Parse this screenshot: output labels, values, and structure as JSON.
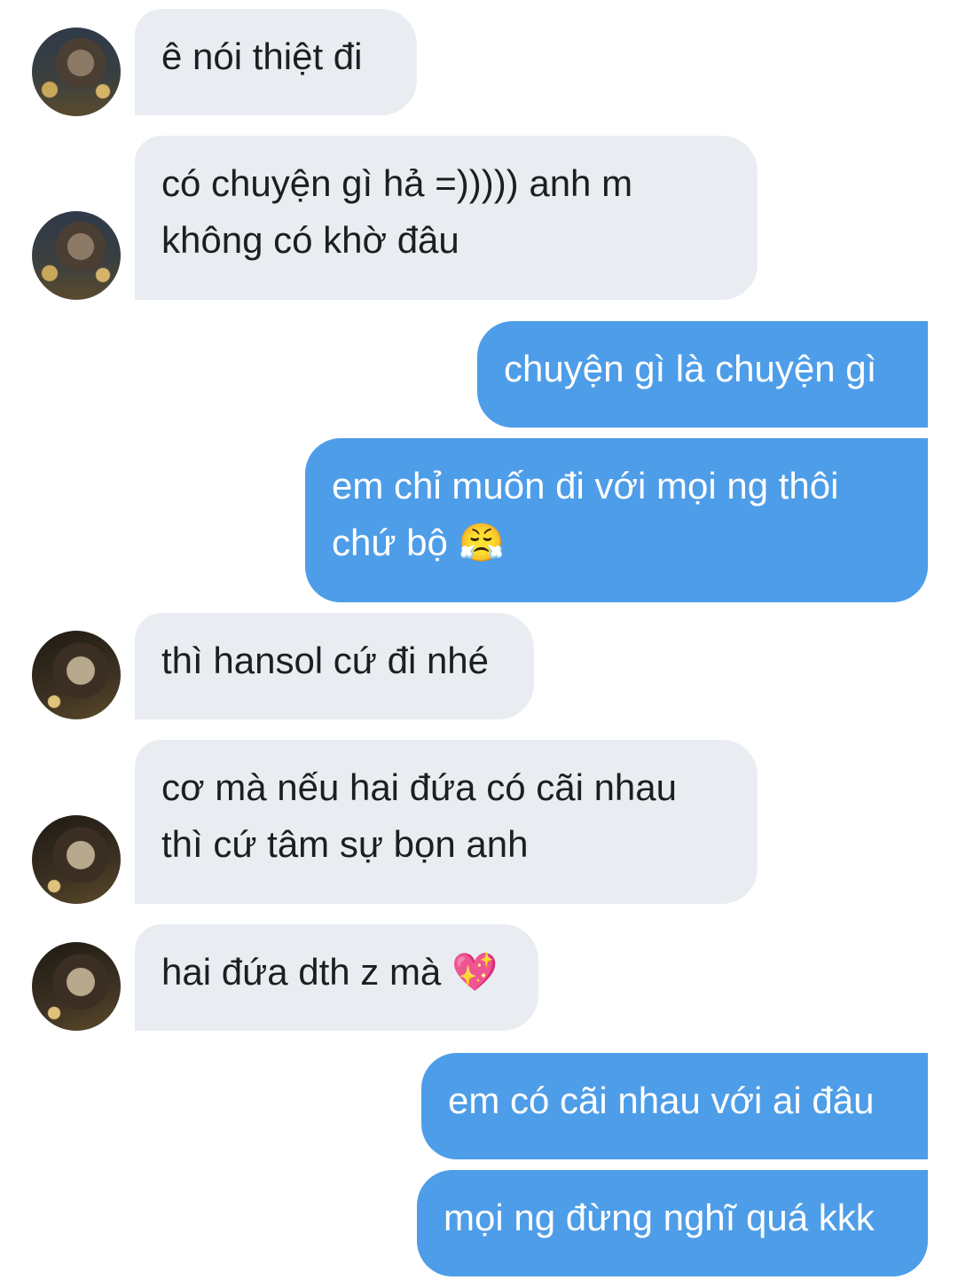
{
  "messages": [
    {
      "side": "in",
      "avatar": "av1",
      "lines": [
        "ê nói thiệt đi"
      ]
    },
    {
      "side": "in",
      "avatar": "av1",
      "lines": [
        "có chuyện gì hả =))))) anh m",
        "không có khờ đâu"
      ]
    },
    {
      "side": "out",
      "lines": [
        "chuyện gì là chuyện gì"
      ]
    },
    {
      "side": "out",
      "lines": [
        "em chỉ muốn đi với mọi ng thôi",
        "chứ bộ"
      ],
      "emoji": "😤"
    },
    {
      "side": "in",
      "avatar": "av2",
      "lines": [
        "thì hansol cứ đi nhé"
      ]
    },
    {
      "side": "in",
      "avatar": "av2",
      "lines": [
        "cơ mà nếu hai đứa có cãi nhau",
        "thì cứ tâm sự bọn anh"
      ]
    },
    {
      "side": "in",
      "avatar": "av2",
      "lines": [
        "hai đứa dth z mà"
      ],
      "emoji": "💖"
    },
    {
      "side": "out",
      "lines": [
        "em có cãi nhau với ai đâu"
      ]
    },
    {
      "side": "out",
      "lines": [
        "mọi ng đừng nghĩ quá kkk"
      ]
    }
  ]
}
